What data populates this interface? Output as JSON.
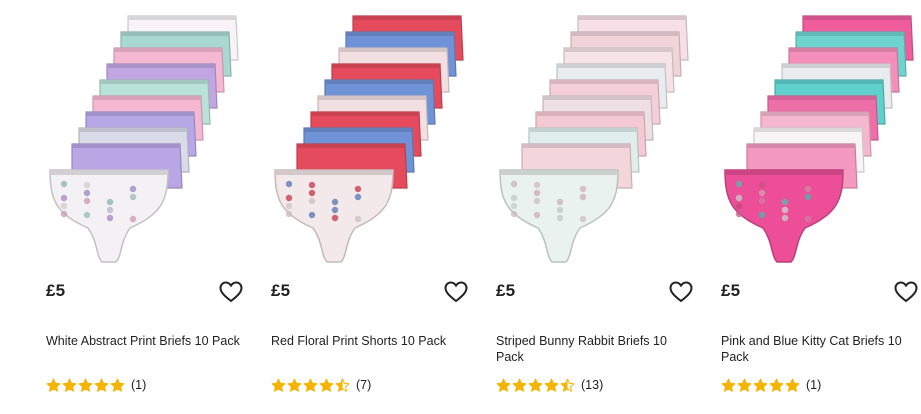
{
  "products": [
    {
      "title": "White Abstract Print Briefs 10 Pack",
      "price": "£5",
      "rating": 5,
      "review_count": "(1)",
      "image_alt": "white abstract print briefs",
      "colors": [
        "#f7f3f6",
        "#a9d8d0",
        "#f4b8d3",
        "#c2a6e3",
        "#b9e2d8",
        "#f4b8d3",
        "#b6a7e6",
        "#d9dbe8",
        "#b9a6e5",
        "#f3f1f4"
      ]
    },
    {
      "title": "Red Floral Print Shorts 10 Pack",
      "price": "£5",
      "rating": 4.5,
      "review_count": "(7)",
      "image_alt": "red floral print shorts",
      "colors": [
        "#e64b5d",
        "#6f93d6",
        "#f2dfe1",
        "#e64b5d",
        "#6f93d6",
        "#f2dfe1",
        "#e64b5d",
        "#6f93d6",
        "#e64b5d",
        "#f4e9ea"
      ]
    },
    {
      "title": "Striped Bunny Rabbit Briefs 10 Pack",
      "price": "£5",
      "rating": 4.5,
      "review_count": "(13)",
      "image_alt": "striped bunny rabbit briefs",
      "colors": [
        "#f6dfe6",
        "#f1d3da",
        "#f5e3e8",
        "#e9ecef",
        "#f4cfd9",
        "#eddfe3",
        "#f5c9d4",
        "#dfeeea",
        "#f3d5dc",
        "#eaf2ef"
      ]
    },
    {
      "title": "Pink and Blue Kitty Cat Briefs 10 Pack",
      "price": "£5",
      "rating": 5,
      "review_count": "(1)",
      "image_alt": "pink and blue kitty cat briefs",
      "colors": [
        "#ef5d9d",
        "#6fd3cf",
        "#f48fbb",
        "#e9ecef",
        "#5fd0cc",
        "#ee6fa7",
        "#f5b7cd",
        "#f7f4f5",
        "#f49ac0",
        "#ec4f98"
      ]
    }
  ],
  "accent": {
    "star": "#f5b400",
    "heart": "#222222"
  }
}
